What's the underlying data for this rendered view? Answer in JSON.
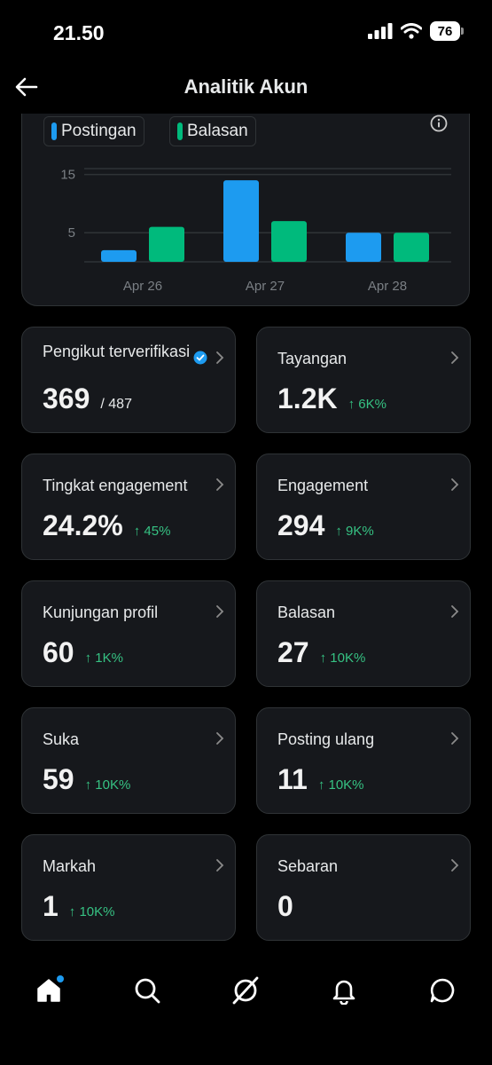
{
  "status_bar": {
    "time": "21.50",
    "battery": "76"
  },
  "header": {
    "title": "Analitik Akun"
  },
  "chart_data": {
    "type": "bar",
    "categories": [
      "Apr 26",
      "Apr 27",
      "Apr 28"
    ],
    "series": [
      {
        "name": "Postingan",
        "values": [
          2,
          14,
          5
        ],
        "color": "#1d9bf0"
      },
      {
        "name": "Balasan",
        "values": [
          6,
          7,
          5
        ],
        "color": "#00ba7c"
      }
    ],
    "yticks": [
      5,
      15
    ],
    "ylim": [
      0,
      16
    ],
    "grid": true,
    "legend": "top-left"
  },
  "legend": {
    "postingan": "Postingan",
    "balasan": "Balasan"
  },
  "stats": {
    "followers": {
      "label": "Pengikut terverifikasi",
      "value": "369",
      "sub": "/ 487"
    },
    "views": {
      "label": "Tayangan",
      "value": "1.2K",
      "change": "↑ 6K%"
    },
    "engagement_rate": {
      "label": "Tingkat engagement",
      "value": "24.2%",
      "change": "↑ 45%"
    },
    "engagement": {
      "label": "Engagement",
      "value": "294",
      "change": "↑ 9K%"
    },
    "profile_visits": {
      "label": "Kunjungan profil",
      "value": "60",
      "change": "↑ 1K%"
    },
    "replies": {
      "label": "Balasan",
      "value": "27",
      "change": "↑ 10K%"
    },
    "likes": {
      "label": "Suka",
      "value": "59",
      "change": "↑ 10K%"
    },
    "reposts": {
      "label": "Posting ulang",
      "value": "11",
      "change": "↑ 10K%"
    },
    "bookmarks": {
      "label": "Markah",
      "value": "1",
      "change": "↑ 10K%"
    },
    "shares": {
      "label": "Sebaran",
      "value": "0"
    }
  },
  "icons": {
    "back": "arrow-left-icon",
    "info": "info-icon",
    "verified": "verified-badge-icon",
    "home": "home-icon",
    "search": "search-icon",
    "grok": "grok-icon",
    "notifications": "bell-icon",
    "messages": "chat-icon"
  },
  "colors": {
    "accent": "#1d9bf0",
    "positive": "#00ba7c",
    "card": "#16181c",
    "border": "#2f3336"
  }
}
